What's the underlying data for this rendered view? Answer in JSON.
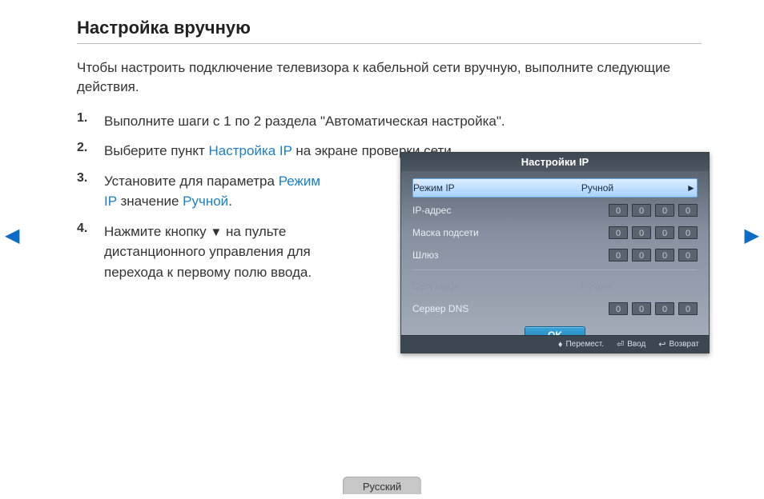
{
  "heading": "Настройка вручную",
  "intro": "Чтобы настроить подключение телевизора к кабельной сети вручную, выполните следующие действия.",
  "steps": {
    "s1_num": "1.",
    "s1_text": "Выполните шаги с 1 по 2 раздела \"Автоматическая настройка\".",
    "s2_num": "2.",
    "s2_a": "Выберите пункт ",
    "s2_hl": "Настройка IP",
    "s2_b": " на экране проверки сети.",
    "s3_num": "3.",
    "s3_a": "Установите для параметра ",
    "s3_hl1": "Режим IP",
    "s3_b": " значение ",
    "s3_hl2": "Ручной",
    "s3_c": ".",
    "s4_num": "4.",
    "s4_a": "Нажмите кнопку ",
    "s4_arrow": "▼",
    "s4_b": " на пульте дистанционного управления для перехода к первому полю ввода."
  },
  "tv": {
    "title": "Настройки IP",
    "rows": {
      "ipmode_label": "Режим IP",
      "ipmode_value": "Ручной",
      "ipaddr_label": "IP-адрес",
      "mask_label": "Маска подсети",
      "gw_label": "Шлюз",
      "dsnmode_label": "DSN Mode",
      "dsnmode_value": "Ручной",
      "dns_label": "Сервер DNS"
    },
    "octet": "0",
    "ok": "OK",
    "footer": {
      "move_glyph": "♦",
      "move": "Перемест.",
      "enter_glyph": "⏎",
      "enter": "Ввод",
      "return_glyph": "↩",
      "return": "Возврат"
    }
  },
  "nav": {
    "left": "◀",
    "right": "▶"
  },
  "lang": "Русский"
}
